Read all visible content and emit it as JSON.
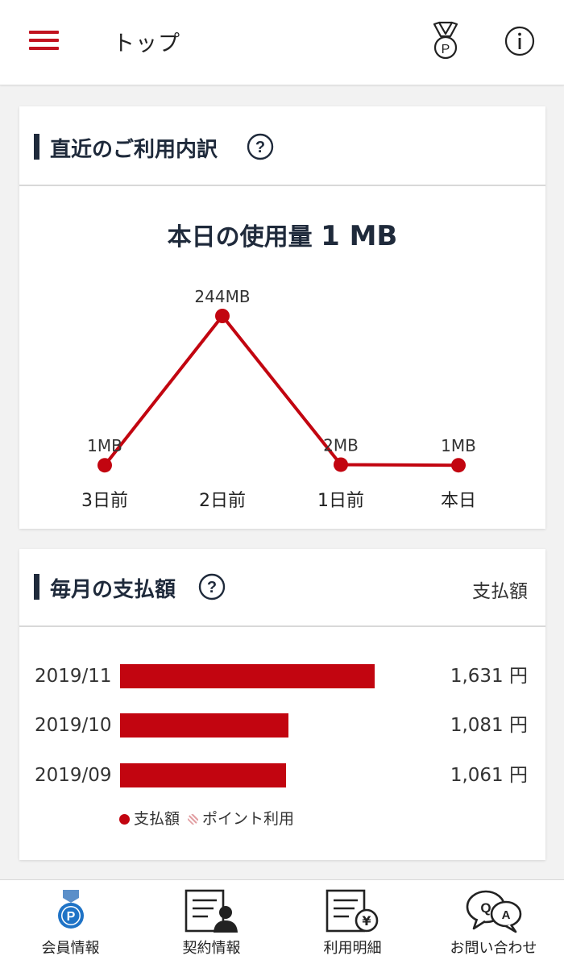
{
  "header": {
    "title": "トップ"
  },
  "usage_card": {
    "title": "直近のご利用内訳",
    "today_label": "本日の使用量",
    "today_value": "1 MB",
    "points": [
      {
        "day": "3日前",
        "label": "1MB"
      },
      {
        "day": "2日前",
        "label": "244MB"
      },
      {
        "day": "1日前",
        "label": "2MB"
      },
      {
        "day": "本日",
        "label": "1MB"
      }
    ]
  },
  "chart_data": {
    "type": "line",
    "categories": [
      "3日前",
      "2日前",
      "1日前",
      "本日"
    ],
    "values": [
      1,
      244,
      2,
      1
    ],
    "data_labels": [
      "1MB",
      "244MB",
      "2MB",
      "1MB"
    ],
    "ylim": [
      0,
      244
    ],
    "grid": false,
    "color": "#c20510"
  },
  "payment_card": {
    "title": "毎月の支払額",
    "right_link": "支払額",
    "rows": [
      {
        "month": "2019/11",
        "amount": "1,631 円",
        "value": 1631
      },
      {
        "month": "2019/10",
        "amount": "1,081 円",
        "value": 1081
      },
      {
        "month": "2019/09",
        "amount": "1,061 円",
        "value": 1061
      }
    ],
    "legend": {
      "paid": "支払額",
      "points": "ポイント利用"
    }
  },
  "bottom_nav": [
    {
      "label": "会員情報",
      "icon": "member-badge-icon"
    },
    {
      "label": "契約情報",
      "icon": "contract-icon"
    },
    {
      "label": "利用明細",
      "icon": "statement-icon"
    },
    {
      "label": "お問い合わせ",
      "icon": "qa-icon"
    }
  ],
  "colors": {
    "accent": "#c20510",
    "heading": "#1f2a3b",
    "member_icon": "#1f73c6"
  }
}
